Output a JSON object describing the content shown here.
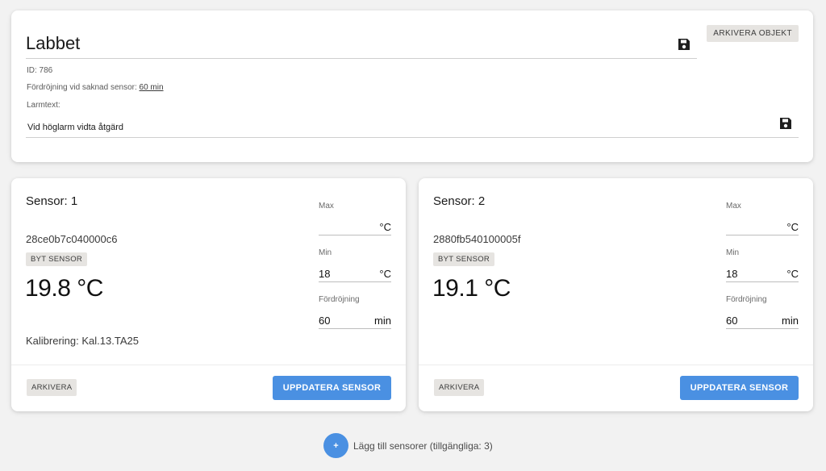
{
  "object": {
    "name": "Labbet",
    "archive_label": "ARKIVERA OBJEKT",
    "id_text": "ID: 786",
    "delay_prefix": "Fördröjning vid saknad sensor:",
    "delay_value": "60 min",
    "alarm_label": "Larmtext:",
    "alarm_text": "Vid höglarm vidta åtgärd",
    "save_icon": "floppy-disk-icon"
  },
  "sensors": [
    {
      "title": "Sensor: 1",
      "hw_id": "28ce0b7c040000c6",
      "swap_label": "BYT SENSOR",
      "temperature": "19.8 °C",
      "calibration": "Kalibrering: Kal.13.TA25",
      "max": {
        "label": "Max",
        "value": "",
        "unit": "°C"
      },
      "min": {
        "label": "Min",
        "value": "18",
        "unit": "°C"
      },
      "delay": {
        "label": "Fördröjning",
        "value": "60",
        "unit": "min"
      },
      "archive_label": "ARKIVERA",
      "update_label": "UPPDATERA SENSOR"
    },
    {
      "title": "Sensor: 2",
      "hw_id": "2880fb540100005f",
      "swap_label": "BYT SENSOR",
      "temperature": "19.1 °C",
      "calibration": "",
      "max": {
        "label": "Max",
        "value": "",
        "unit": "°C"
      },
      "min": {
        "label": "Min",
        "value": "18",
        "unit": "°C"
      },
      "delay": {
        "label": "Fördröjning",
        "value": "60",
        "unit": "min"
      },
      "archive_label": "ARKIVERA",
      "update_label": "UPPDATERA SENSOR"
    }
  ],
  "add_sensors": {
    "button_symbol": "+",
    "label": "Lägg till sensorer (tillgängliga: 3)"
  },
  "colors": {
    "background": "#f2f2f2",
    "card": "#ffffff",
    "accent": "#4a90e2",
    "chip": "#e6e4e1"
  }
}
